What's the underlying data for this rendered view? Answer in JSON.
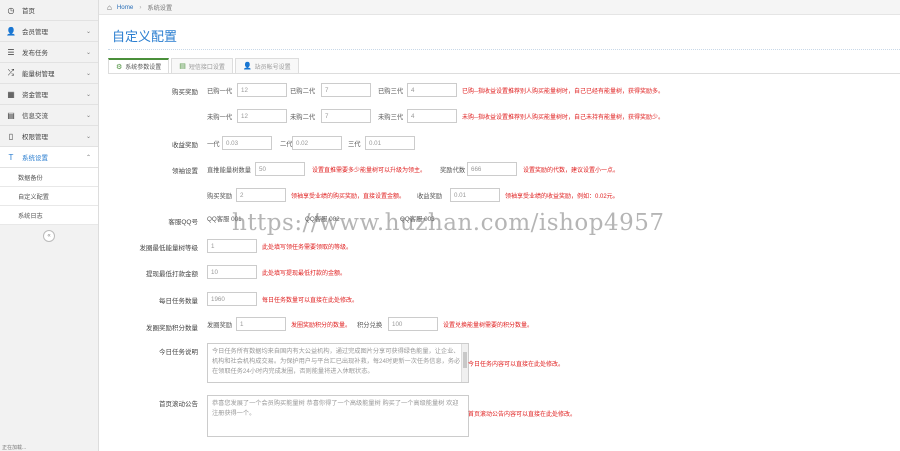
{
  "sidebar": {
    "items": [
      {
        "label": "首页",
        "icon": "dashboard-icon",
        "glyph": "◷"
      },
      {
        "label": "会员管理",
        "icon": "user-icon",
        "glyph": "👤"
      },
      {
        "label": "发布任务",
        "icon": "list-icon",
        "glyph": "☰"
      },
      {
        "label": "能量树管理",
        "icon": "shuffle-icon",
        "glyph": "⤮"
      },
      {
        "label": "资金管理",
        "icon": "calendar-icon",
        "glyph": "▦"
      },
      {
        "label": "信息交流",
        "icon": "chat-icon",
        "glyph": "▤"
      },
      {
        "label": "权限管理",
        "icon": "doc-icon",
        "glyph": "▯"
      },
      {
        "label": "系统设置",
        "icon": "text-icon",
        "glyph": "T"
      }
    ],
    "sub_items": [
      "数据备份",
      "自定义配置",
      "系统日志"
    ],
    "collapse_glyph": "«",
    "bottom_text": "正在加载..."
  },
  "breadcrumb": {
    "home": "Home",
    "separator": "›",
    "current": "系统设置"
  },
  "page_title": "自定义配置",
  "tabs": [
    {
      "label": "系统参数设置",
      "glyph": "⚙"
    },
    {
      "label": "短信接口设置",
      "glyph": "▤"
    },
    {
      "label": "站员帐号设置",
      "glyph": "👤"
    }
  ],
  "form": {
    "buy_reward": {
      "label": "购买奖励",
      "row1": {
        "g1": "已购一代",
        "v1": "12",
        "g2": "已购二代",
        "v2": "7",
        "g3": "已购三代",
        "v3": "4",
        "note": "已购--指收益设置推荐别人购买能量树时，自己已经有能量树，获得奖励多。"
      },
      "row2": {
        "g1": "未购一代",
        "v1": "12",
        "g2": "未购二代",
        "v2": "7",
        "g3": "未购三代",
        "v3": "4",
        "note": "未购--指收益设置推荐别人购买能量树时，自己未持有能量树，获得奖励少。"
      }
    },
    "income_reward": {
      "label": "收益奖励",
      "g1": "一代",
      "v1": "0.03",
      "g2": "二代",
      "v2": "0.02",
      "g3": "三代",
      "v3": "0.01"
    },
    "team_setting": {
      "label": "领袖设置",
      "direct_label": "直推能量树数量",
      "direct_value": "50",
      "direct_note": "设置直推需要多少能量树可以升级为领主。",
      "reward_gen_label": "奖励代数",
      "reward_gen_value": "666",
      "reward_gen_note": "设置奖励的代数，建议设置小一点。",
      "buy_reward_label": "购买奖励",
      "buy_reward_value": "2",
      "buy_reward_note": "领袖享受业绩的购买奖励，直接设置金额。",
      "income_reward_label": "收益奖励",
      "income_reward_value": "0.01",
      "income_reward_note": "领袖享受业绩的收益奖励，例如：0.02元。"
    },
    "service_qq": {
      "label": "客服QQ号",
      "items": [
        "QQ客服 001",
        "QQ客服 002",
        "QQ客服 003"
      ]
    },
    "min_task_level": {
      "label": "发圈最低能量树等级",
      "value": "1",
      "note": "此处填写领任务需要领取的等级。"
    },
    "withdraw_multiple": {
      "label": "提现最低打款金额",
      "value": "10",
      "note": "此处填写提现最低打款的金额。"
    },
    "daily_tasks": {
      "label": "每日任务数量",
      "value": "1960",
      "note": "每日任务数量可以直接在此处修改。"
    },
    "task_reward_count": {
      "label": "发圈奖励积分数量",
      "g1": "发圈奖励",
      "v1": "1",
      "note1": "发圈奖励积分的数量。",
      "g2": "积分兑换",
      "v2": "100",
      "note2": "设置兑换能量树需要的积分数量。"
    },
    "daily_notice": {
      "label": "今日任务说明",
      "value": "今日任务所有数据均来自国内有大公益机构，通过完成图片分享可获得绿色能量，让企业、机构和社会机构成交易。为保护用户与平台汇已出现补救，每24时更新一次任务信息，务必在领取任务24小时内完成发圈，否则能量将进入休眠状态。",
      "note": "今日任务内容可以直接在此处修改。"
    },
    "scroll_notice": {
      "label": "首页滚动公告",
      "value": "恭喜您发展了一个会员购买能量树 恭喜你得了一个高级能量树 购买了一个高级能量树 欢迎注册获得一个。",
      "note": "首页滚动公告内容可以直接在此处修改。"
    }
  },
  "watermark": "https://www.huzhan.com/ishop4957"
}
